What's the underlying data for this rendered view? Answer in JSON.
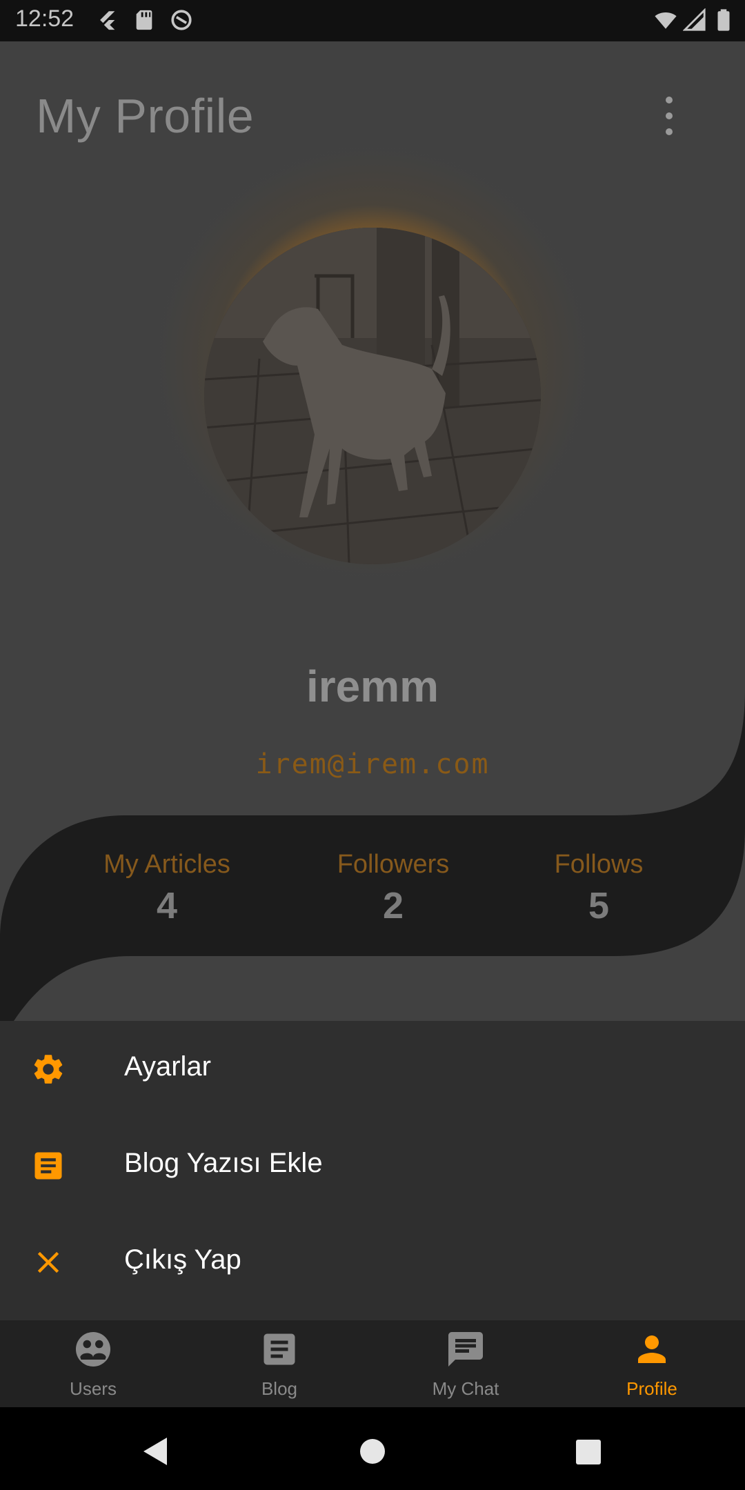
{
  "status_bar": {
    "time": "12:52"
  },
  "header": {
    "title": "My Profile"
  },
  "profile": {
    "username": "iremm",
    "email": "irem@irem.com"
  },
  "stats": [
    {
      "label": "My Articles",
      "value": "4"
    },
    {
      "label": "Followers",
      "value": "2"
    },
    {
      "label": "Follows",
      "value": "5"
    }
  ],
  "menu": {
    "items": [
      {
        "label": "Ayarlar",
        "icon": "gear-icon"
      },
      {
        "label": "Blog Yazısı Ekle",
        "icon": "article-icon"
      },
      {
        "label": "Çıkış Yap",
        "icon": "close-icon"
      }
    ]
  },
  "bottom_nav": {
    "items": [
      {
        "label": "Users",
        "icon": "users-icon"
      },
      {
        "label": "Blog",
        "icon": "blog-icon"
      },
      {
        "label": "My Chat",
        "icon": "chat-icon"
      },
      {
        "label": "Profile",
        "icon": "person-icon",
        "active": true
      }
    ]
  },
  "colors": {
    "accent": "#ff9800",
    "background": "#414141",
    "sheet": "#2f2f2f",
    "band": "#1c1c1c"
  }
}
